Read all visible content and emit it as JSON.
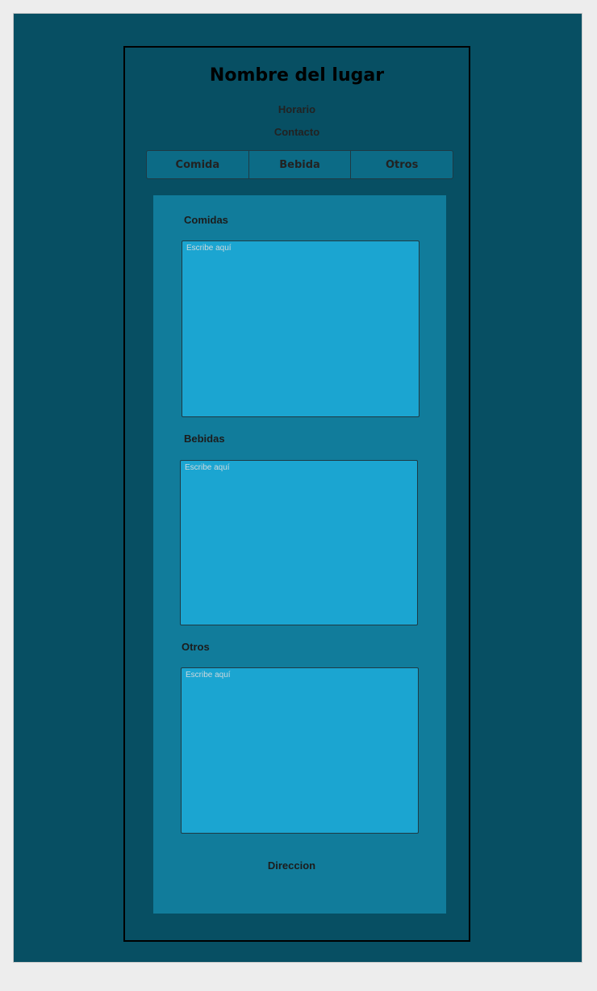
{
  "header": {
    "title": "Nombre del lugar",
    "horario": "Horario",
    "contacto": "Contacto"
  },
  "tabs": [
    {
      "label": "Comida"
    },
    {
      "label": "Bebida"
    },
    {
      "label": "Otros"
    }
  ],
  "sections": [
    {
      "label": "Comidas",
      "placeholder": "Escribe aquí"
    },
    {
      "label": "Bebidas",
      "placeholder": "Escribe aquí"
    },
    {
      "label": "Otros",
      "placeholder": "Escribe aquí"
    }
  ],
  "footer": {
    "direccion": "Direccion"
  },
  "colors": {
    "background": "#074f63",
    "panel": "#117c9b",
    "input": "#1ba5d1",
    "tabs": "#0c6b86"
  }
}
